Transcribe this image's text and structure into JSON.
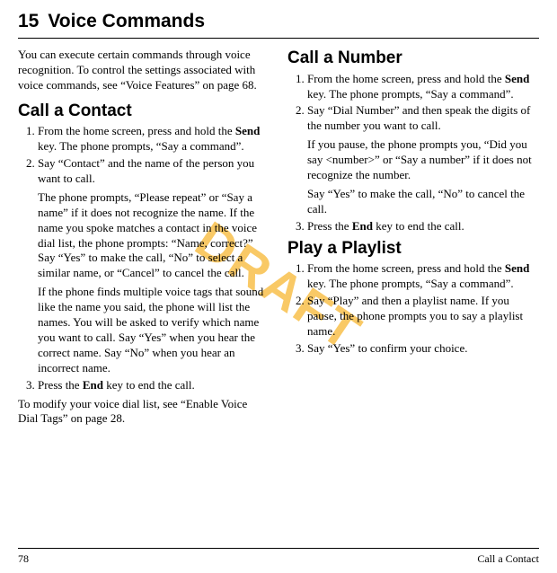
{
  "chapter": {
    "number": "15",
    "title": "Voice Commands"
  },
  "watermark": "DRAFT",
  "left": {
    "intro": "You can execute certain commands through voice recognition. To control the settings associated with voice commands, see “Voice Features” on page 68.",
    "section1": {
      "heading": "Call a Contact",
      "step1a": "From the home screen, press and hold the ",
      "step1bold": "Send",
      "step1b": " key. The phone prompts, “Say a command”.",
      "step2": "Say “Contact” and the name of the person you want to call.",
      "step2p1": "The phone prompts, “Please repeat” or “Say a name” if it does not recognize the name. If the name you spoke matches a contact in the voice dial list, the phone prompts: “Name, correct?” Say “Yes” to make the call, “No” to select a similar name, or “Cancel” to cancel the call.",
      "step2p2": "If the phone finds multiple voice tags that sound like the name you said, the phone will list the names. You will be asked to verify which name you want to call. Say “Yes” when you hear the correct name. Say “No” when you hear an incorrect name.",
      "step3a": "Press the ",
      "step3bold": "End",
      "step3b": " key to end the call.",
      "after": "To modify your voice dial list, see “Enable Voice Dial Tags” on page 28."
    }
  },
  "right": {
    "section2": {
      "heading": "Call a Number",
      "step1a": "From the home screen, press and hold the ",
      "step1bold": "Send",
      "step1b": " key. The phone prompts, “Say a command”.",
      "step2": "Say “Dial Number” and then speak the digits of the number you want to call.",
      "step2p1": " If you pause, the phone prompts you, “Did you say <number>” or “Say a number” if it does not recognize the number.",
      "step2p2": "Say “Yes” to make the call, “No” to cancel the call.",
      "step3a": "Press the ",
      "step3bold": "End",
      "step3b": " key to end the call."
    },
    "section3": {
      "heading": "Play a Playlist",
      "step1a": "From the home screen, press and hold the ",
      "step1bold": "Send",
      "step1b": " key. The phone prompts, “Say a command”.",
      "step2": "Say “Play” and then a playlist name. If you pause, the phone prompts you to say a playlist name.",
      "step3": "Say “Yes” to confirm your choice."
    }
  },
  "footer": {
    "pageNumber": "78",
    "sectionRef": "Call a Contact"
  }
}
